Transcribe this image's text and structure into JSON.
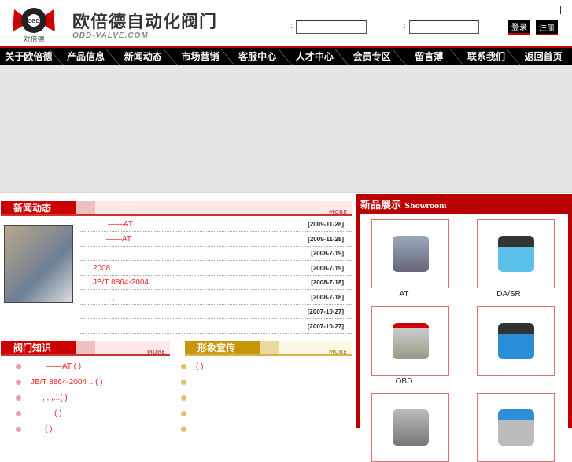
{
  "header": {
    "logo_text": "OBD 欧倍德",
    "brand": "欧倍德自动化阀门",
    "domain": "OBD-VALVE.COM",
    "colon1": ":",
    "colon2": ":",
    "login": "登录",
    "register": "注册"
  },
  "nav": [
    "关于欧倍德",
    "产品信息",
    "新闻动态",
    "市场营销",
    "客服中心",
    "人才中心",
    "会员专区",
    "留言薄",
    "联系我们",
    "返回首页"
  ],
  "news": {
    "title": "新闻动态",
    "more": "MORE",
    "items": [
      {
        "t": "——AT",
        "d": "[2009-11-28]"
      },
      {
        "t": "——AT",
        "d": "[2009-11-28]"
      },
      {
        "t": "",
        "d": "[2008-7-19]"
      },
      {
        "t": "2008",
        "d": "[2008-7-19]"
      },
      {
        "t": "JB/T 8864-2004",
        "d": "[2008-7-18]"
      },
      {
        "t": ",   ,  ,",
        "d": "[2008-7-18]"
      },
      {
        "t": "",
        "d": "[2007-10-27]"
      },
      {
        "t": "",
        "d": "[2007-10-27]"
      }
    ]
  },
  "knowledge": {
    "title": "阀门知识",
    "more": "MORE",
    "items": [
      "——AT ( )",
      "JB/T 8864-2004    ...( )",
      ",    ,  ,...( )",
      "( )",
      "( )"
    ]
  },
  "image": {
    "title": "形象宣传",
    "more": "MORE",
    "items": [
      "( )",
      "",
      "",
      "",
      ""
    ]
  },
  "showroom": {
    "title": "新品展示",
    "subtitle": "Showroom",
    "products": [
      "AT",
      "DA/SR",
      "OBD",
      "",
      "",
      ""
    ]
  }
}
